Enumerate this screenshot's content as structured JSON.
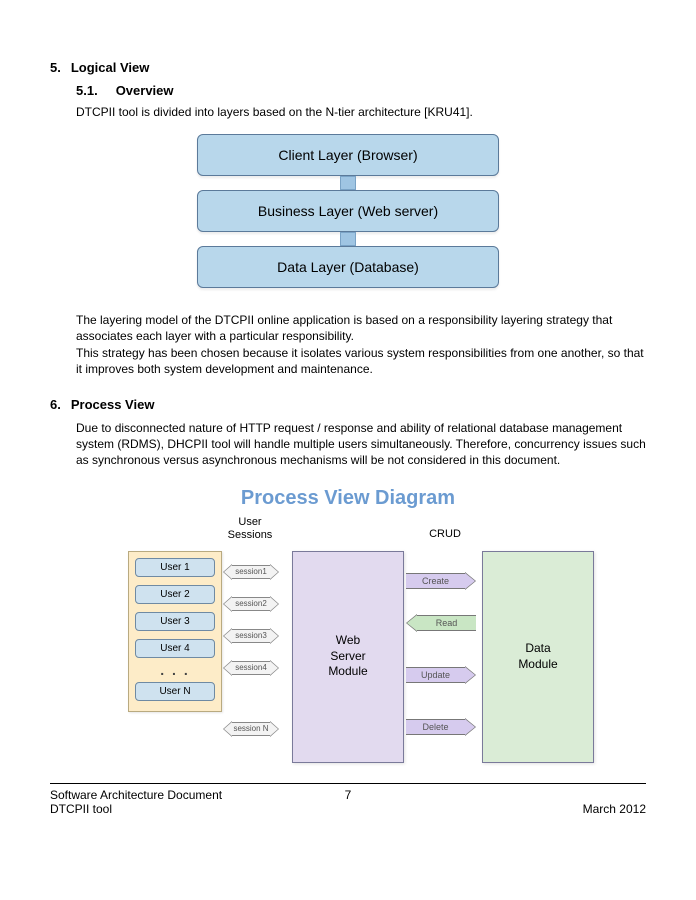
{
  "sections": {
    "s5": {
      "num": "5.",
      "title": "Logical View"
    },
    "s51": {
      "num": "5.1.",
      "title": "Overview"
    },
    "s5_intro": "DTCPII tool is divided into layers based on the N-tier architecture [KRU41].",
    "s5_para1": "The layering model of the DTCPII online application is based on a responsibility layering strategy that associates each layer with a particular responsibility.",
    "s5_para2": "This strategy has been chosen because it isolates various system responsibilities from one another, so that it improves both system development and maintenance.",
    "s6": {
      "num": "6.",
      "title": "Process View"
    },
    "s6_para": "Due to disconnected nature of HTTP request / response and ability of relational database management system (RDMS), DHCPII tool will handle multiple users simultaneously. Therefore, concurrency issues such as synchronous versus asynchronous mechanisms will be not considered in this document."
  },
  "layer_diagram": {
    "layers": [
      "Client Layer (Browser)",
      "Business Layer (Web server)",
      "Data Layer (Database)"
    ]
  },
  "process_diagram": {
    "title": "Process View Diagram",
    "labels": {
      "user_sessions_l1": "User",
      "user_sessions_l2": "Sessions",
      "crud": "CRUD"
    },
    "users": [
      "User 1",
      "User 2",
      "User 3",
      "User 4",
      "User N"
    ],
    "sessions": [
      "session1",
      "session2",
      "session3",
      "session4",
      "session N"
    ],
    "web_module": "Web\nServer\nModule",
    "data_module": "Data\nModule",
    "crud_ops": [
      "Create",
      "Read",
      "Update",
      "Delete"
    ]
  },
  "footer": {
    "left_l1": "Software Architecture Document",
    "left_l2": "DTCPII tool",
    "center": "7",
    "right": "March 2012"
  }
}
